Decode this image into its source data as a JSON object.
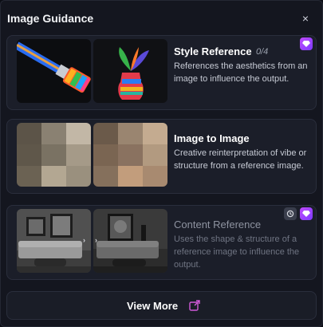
{
  "header": {
    "title": "Image Guidance",
    "close_glyph": "×"
  },
  "cards": [
    {
      "title": "Style Reference",
      "count": "0/4",
      "description": "References the aesthetics from an image to influence the output.",
      "badges": [
        "premium-gem-icon"
      ]
    },
    {
      "title": "Image to Image",
      "description": "Creative reinterpretation of vibe or structure from a reference image."
    },
    {
      "title": "Content Reference",
      "description": "Uses the shape & structure of a reference image to influence the output.",
      "badges": [
        "history-icon",
        "premium-gem-icon"
      ]
    }
  ],
  "footer": {
    "view_more_label": "View More"
  },
  "colors": {
    "premium_badge": "#b048ff",
    "external_link": "#d05ad8",
    "panel_bg": "#14161f",
    "card_bg": "#1b1e29"
  }
}
